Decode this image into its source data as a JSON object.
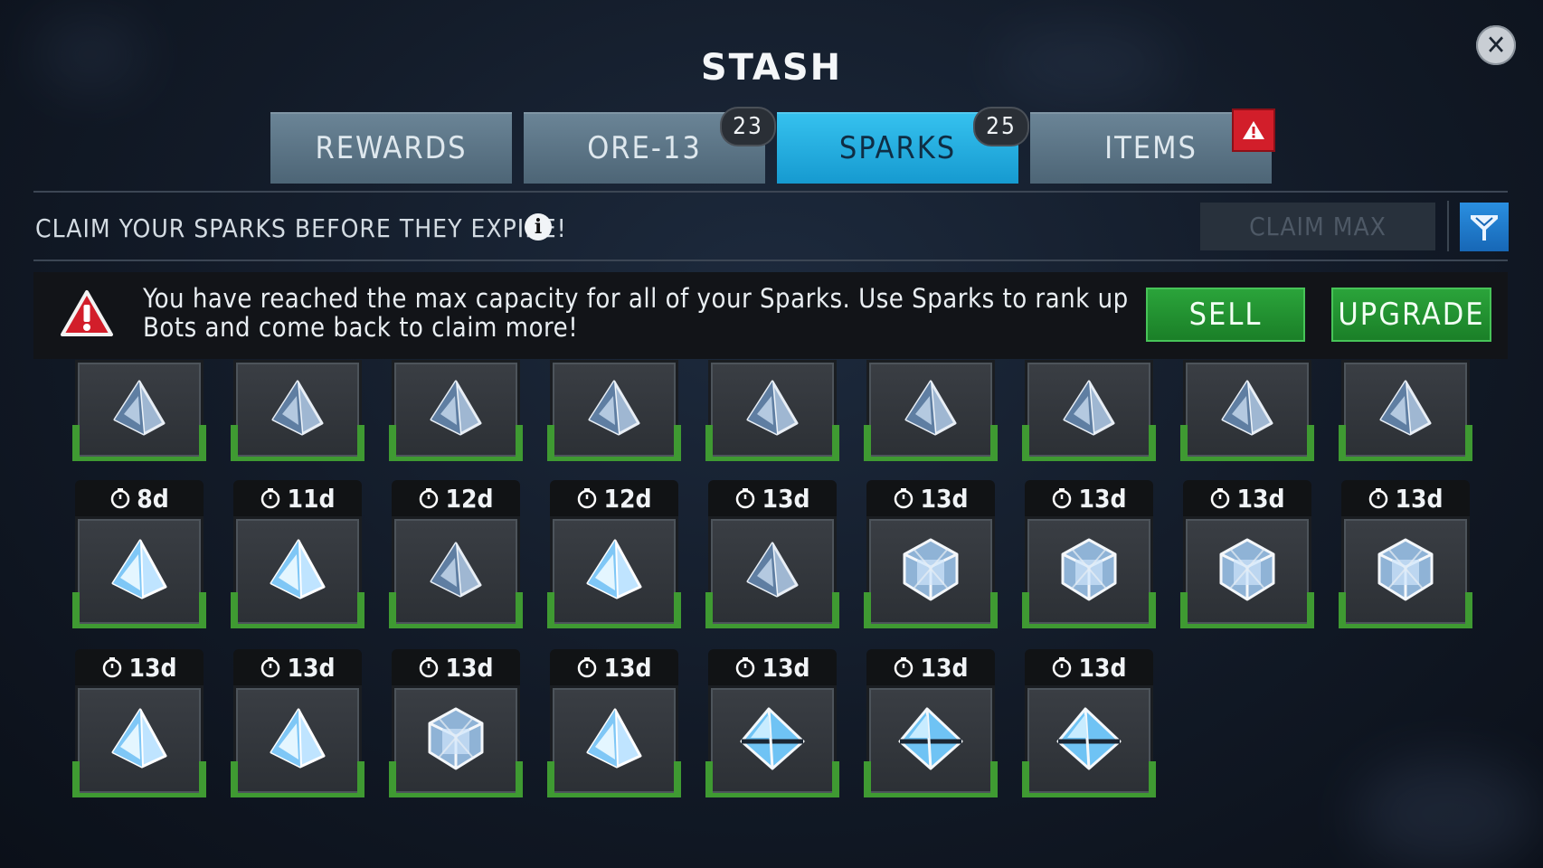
{
  "title": "STASH",
  "tabs": [
    {
      "label": "REWARDS",
      "badge": null,
      "alert": false,
      "active": false
    },
    {
      "label": "ORE-13",
      "badge": "23",
      "alert": false,
      "active": false
    },
    {
      "label": "SPARKS",
      "badge": "25",
      "alert": false,
      "active": true
    },
    {
      "label": "ITEMS",
      "badge": null,
      "alert": true,
      "active": false
    }
  ],
  "claim_bar": {
    "text": "CLAIM YOUR SPARKS BEFORE THEY EXPIRE!",
    "claim_max_label": "CLAIM MAX"
  },
  "warning": {
    "text": "You have reached the max capacity for all of your Sparks. Use Sparks to rank up Bots and come back to claim more!",
    "sell_label": "SELL",
    "upgrade_label": "UPGRADE"
  },
  "sparks_rows": [
    [
      {
        "timer": null,
        "icon": "pyramid-spark-icon"
      },
      {
        "timer": null,
        "icon": "pyramid-spark-icon"
      },
      {
        "timer": null,
        "icon": "pyramid-spark-icon"
      },
      {
        "timer": null,
        "icon": "pyramid-spark-icon"
      },
      {
        "timer": null,
        "icon": "pyramid-spark-icon"
      },
      {
        "timer": null,
        "icon": "pyramid-spark-icon"
      },
      {
        "timer": null,
        "icon": "pyramid-spark-icon"
      },
      {
        "timer": null,
        "icon": "pyramid-spark-icon"
      },
      {
        "timer": null,
        "icon": "pyramid-spark-icon"
      }
    ],
    [
      {
        "timer": "8d",
        "icon": "bright-pyramid-spark-icon"
      },
      {
        "timer": "11d",
        "icon": "bright-pyramid-spark-icon"
      },
      {
        "timer": "12d",
        "icon": "pyramid-spark-icon"
      },
      {
        "timer": "12d",
        "icon": "bright-pyramid-spark-icon"
      },
      {
        "timer": "13d",
        "icon": "pyramid-spark-icon"
      },
      {
        "timer": "13d",
        "icon": "cube-spark-icon"
      },
      {
        "timer": "13d",
        "icon": "cube-spark-icon"
      },
      {
        "timer": "13d",
        "icon": "cube-spark-icon"
      },
      {
        "timer": "13d",
        "icon": "cube-spark-icon"
      }
    ],
    [
      {
        "timer": "13d",
        "icon": "bright-pyramid-spark-icon"
      },
      {
        "timer": "13d",
        "icon": "bright-pyramid-spark-icon"
      },
      {
        "timer": "13d",
        "icon": "cube-spark-icon"
      },
      {
        "timer": "13d",
        "icon": "bright-pyramid-spark-icon"
      },
      {
        "timer": "13d",
        "icon": "octahedron-spark-icon"
      },
      {
        "timer": "13d",
        "icon": "octahedron-spark-icon"
      },
      {
        "timer": "13d",
        "icon": "octahedron-spark-icon"
      }
    ]
  ]
}
